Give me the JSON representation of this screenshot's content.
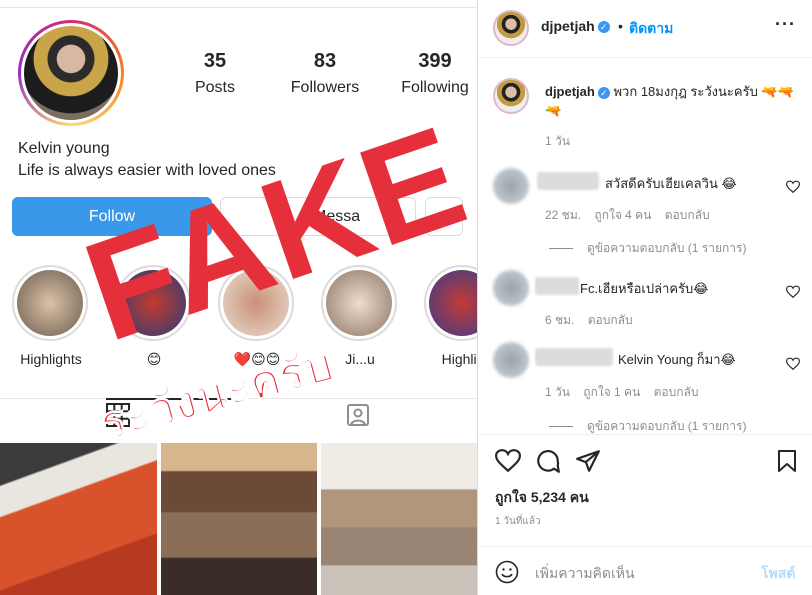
{
  "profile": {
    "stats": [
      {
        "num": "35",
        "label": "Posts"
      },
      {
        "num": "83",
        "label": "Followers"
      },
      {
        "num": "399",
        "label": "Following"
      }
    ],
    "name": "Kelvin young",
    "bio": "Life is always easier with loved ones",
    "follow_label": "Follow",
    "message_label": "Messa",
    "highlights": [
      {
        "caption": "Highlights"
      },
      {
        "caption": "😊"
      },
      {
        "caption": "❤️😊😊"
      },
      {
        "caption": "Ji...u"
      },
      {
        "caption": "Highlig"
      }
    ]
  },
  "overlay": {
    "fake_text": "FAKE",
    "warning_text": "ระวังนะครับ"
  },
  "post": {
    "username": "djpetjah",
    "dot": "•",
    "follow_link": "ติดตาม",
    "caption_user": "djpetjah",
    "caption_text": "พวก 18มงกุฎ ระวังนะครับ 🔫🔫🔫",
    "caption_time": "1 วัน",
    "comments": [
      {
        "text": "สวัสดีครับเฮียเคลวิน 😂",
        "meta": [
          "22 ชม.",
          "ถูกใจ 4 คน",
          "ตอบกลับ"
        ],
        "replies": "ดูข้อความตอบกลับ (1 รายการ)"
      },
      {
        "text": "Fc.เฮียหรือเปล่าครับ😂",
        "meta": [
          "6 ชม.",
          "ตอบกลับ"
        ]
      },
      {
        "text": "Kelvin Young ก็มา😂",
        "meta": [
          "1 วัน",
          "ถูกใจ 1 คน",
          "ตอบกลับ"
        ],
        "replies": "ดูข้อความตอบกลับ (1 รายการ)"
      }
    ],
    "likes": "ถูกใจ 5,234 คน",
    "posted": "1 วันที่แล้ว",
    "comment_placeholder": "เพิ่มความคิดเห็น",
    "post_label": "โพสต์"
  },
  "colors": {
    "accent": "#0095f6",
    "follow_button": "#3a98ea",
    "fake_red": "#e5303c",
    "muted": "#8e8e8e"
  }
}
